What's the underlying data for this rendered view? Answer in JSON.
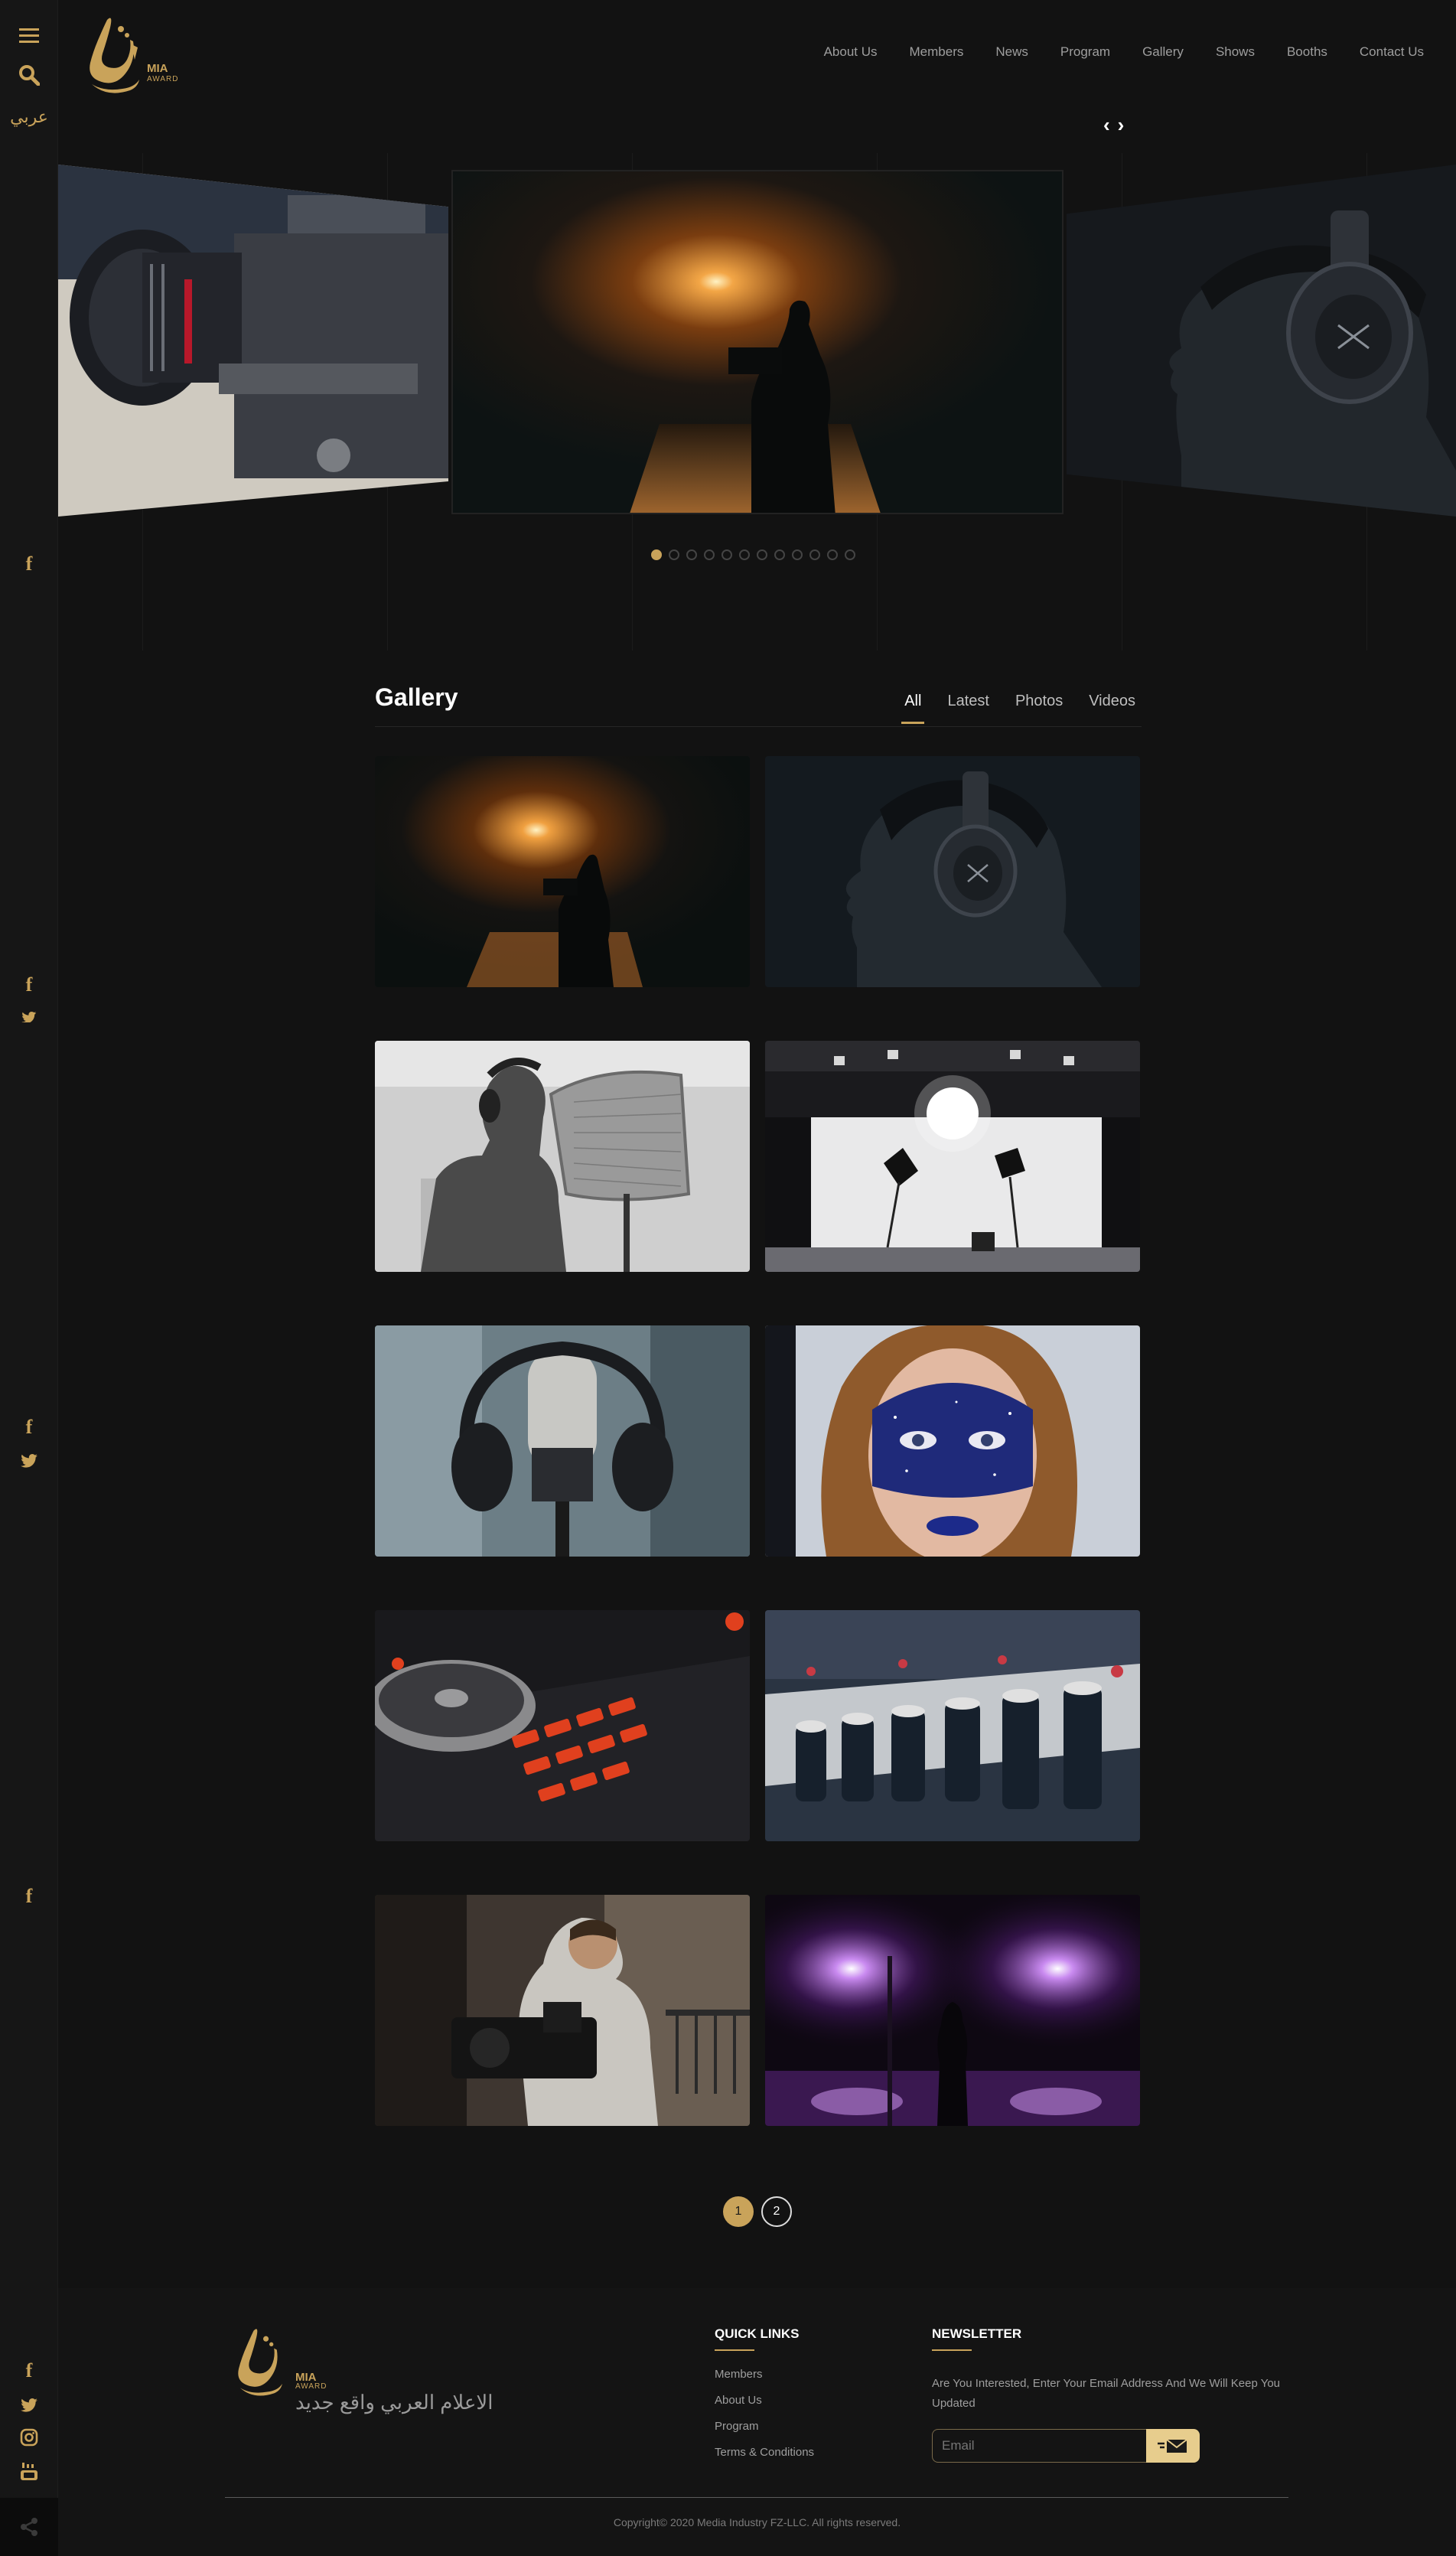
{
  "sidebar": {
    "menu_icon": "hamburger-icon",
    "search_icon": "search-icon",
    "lang_toggle": "عربي",
    "fb_glyph": "f",
    "share_icon": "share-icon"
  },
  "brand": {
    "name_line1": "MIA",
    "name_line2": "AWARD",
    "accent_color": "#c9a35a"
  },
  "nav": {
    "items": [
      "About Us",
      "Members",
      "News",
      "Program",
      "Gallery",
      "Shows",
      "Booths",
      "Contact Us"
    ]
  },
  "hero": {
    "prev_icon": "‹",
    "next_icon": "›",
    "slide_count": 12,
    "active_slide": 1
  },
  "gallery": {
    "title": "Gallery",
    "tabs": [
      "All",
      "Latest",
      "Photos",
      "Videos"
    ],
    "active_tab": "All",
    "items": [
      "silhouette-camera-operator",
      "man-with-headphones",
      "man-singing-at-microphone",
      "photo-studio-lights",
      "headphones-on-microphone",
      "face-paint-portrait",
      "dj-controller",
      "mixing-console",
      "man-with-camera-rig",
      "purple-stage-lights"
    ]
  },
  "pagination": {
    "pages": [
      "1",
      "2"
    ],
    "current": "1"
  },
  "footer": {
    "arabic_tagline": "الاعلام العربي واقع جديد",
    "quick_links_title": "QUICK LINKS",
    "quick_links": [
      "Members",
      "About Us",
      "Program",
      "Terms & Conditions"
    ],
    "newsletter_title": "NEWSLETTER",
    "newsletter_text": "Are You Interested, Enter Your Email Address And We Will Keep You Updated",
    "email_placeholder": "Email",
    "copyright": "Copyright© 2020 Media Industry FZ-LLC. All rights reserved."
  }
}
